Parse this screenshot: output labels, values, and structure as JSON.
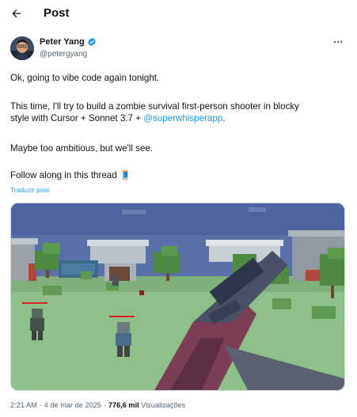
{
  "header": {
    "title": "Post"
  },
  "author": {
    "name": "Peter Yang",
    "handle": "@petergyang"
  },
  "tweet": {
    "line1": "Ok, going to vibe code again tonight.",
    "line2a": "This time, I'll try to build a zombie survival first-person shooter in blocky",
    "line2b": "style with Cursor + Sonnet 3.7 + ",
    "mention": "@superwhisperapp",
    "line2c": ".",
    "line3": "Maybe too ambitious, but we'll see.",
    "line4": "Follow along in this thread",
    "emoji": "🧵"
  },
  "translate_label": "Traduzir post",
  "media": {
    "labels": [
      "Zombie",
      "Zombie",
      "Zombie"
    ]
  },
  "meta": {
    "time": "2:21 AM",
    "separator": "·",
    "date": "4 de mar de 2025",
    "views_count": "776,6 mil",
    "views_label": "Visualizações"
  },
  "colors": {
    "accent": "#1d9bf0",
    "text": "#0f1419",
    "muted": "#536471"
  }
}
